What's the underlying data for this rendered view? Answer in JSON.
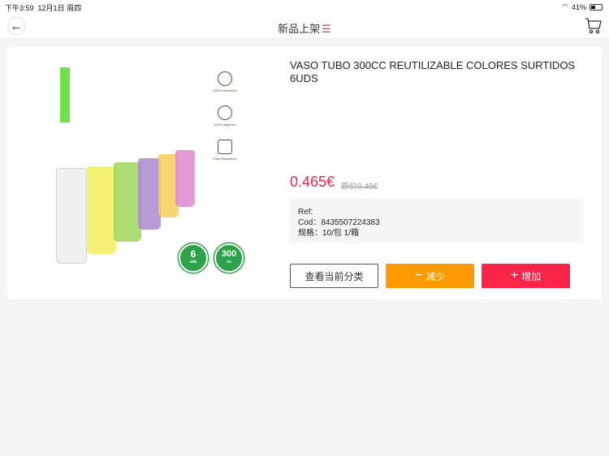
{
  "status": {
    "time": "下午3:59",
    "date": "12月1日 周四",
    "battery": "41%",
    "battery_level": 0.41
  },
  "nav": {
    "title": "新品上架",
    "menu_icon": "menu-lines-icon"
  },
  "product": {
    "name": "VASO TUBO 300CC REUTILIZABLE COLORES SURTIDOS 6UDS",
    "price": "0.465€",
    "original_price": "原价0.49€",
    "ref": "Ref:",
    "cod": "Cod：8435507224383",
    "spec": "规格：10/包 1/箱",
    "image_features": [
      "100% Reciclable",
      "100% Higiénico",
      "Extra Resistente"
    ],
    "badges": [
      {
        "big": "6",
        "small": "uds"
      },
      {
        "big": "300",
        "small": "cc"
      }
    ],
    "cup_colors": [
      "#eeeeee",
      "#f2ee5a",
      "#9fd65a",
      "#a98ad0",
      "#f8cd5a",
      "#dd8ad0"
    ]
  },
  "buttons": {
    "category": "查看当前分类",
    "decrease": "减少",
    "increase": "增加"
  }
}
